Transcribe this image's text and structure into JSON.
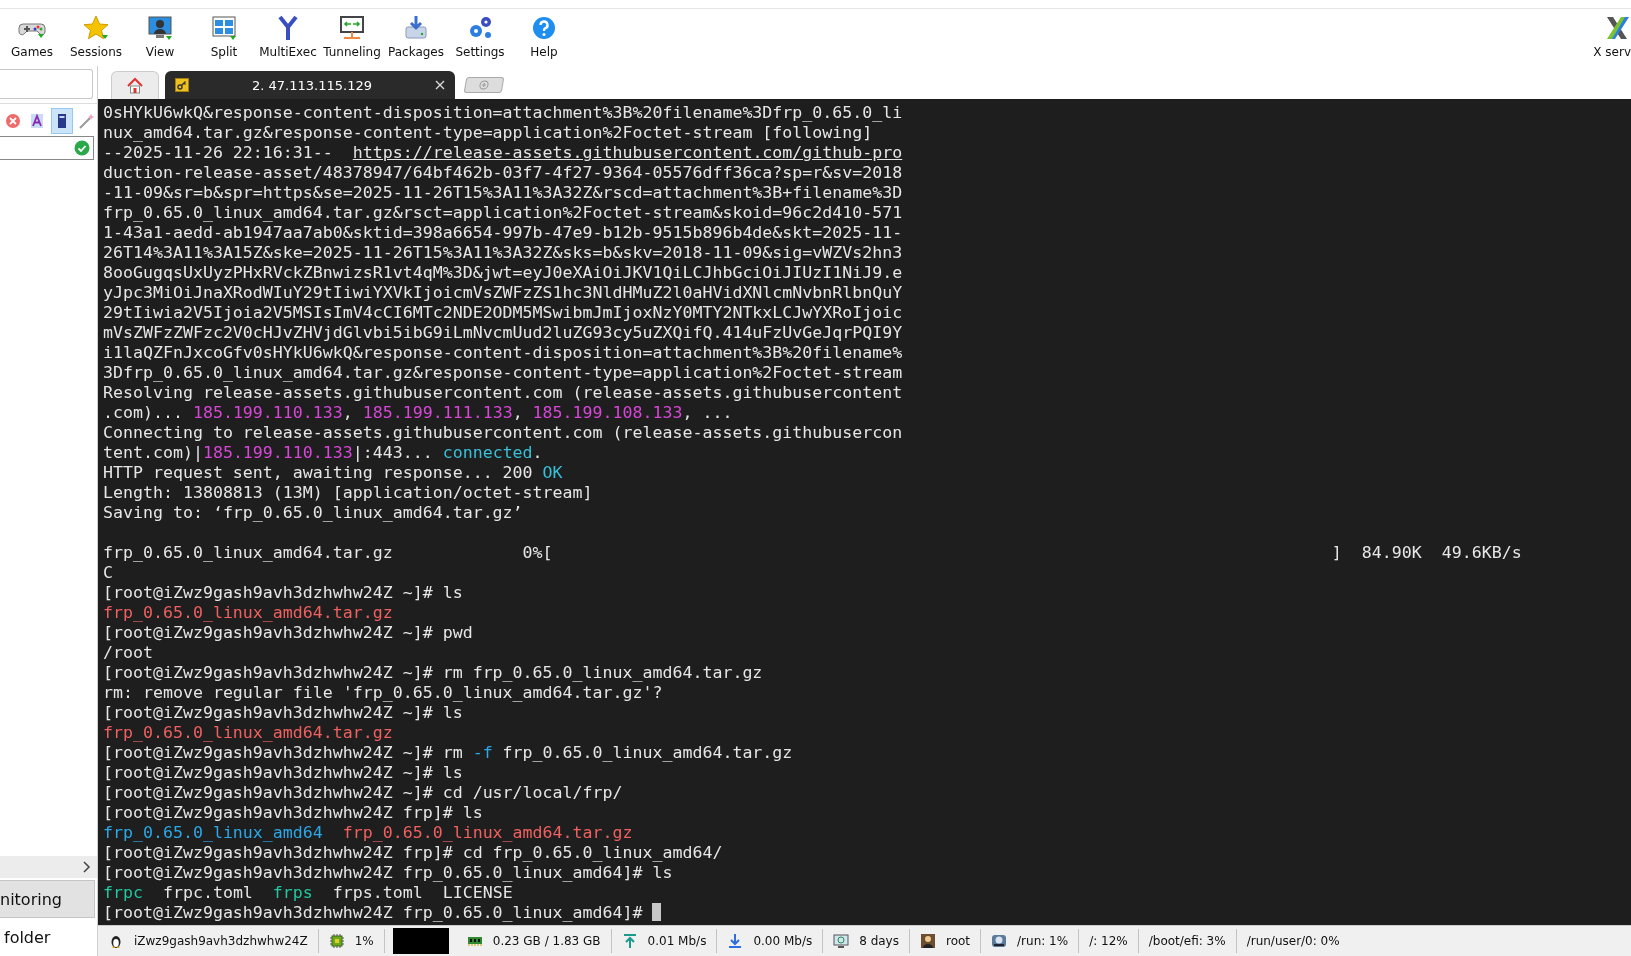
{
  "toolbar": {
    "items": [
      {
        "label": "Games"
      },
      {
        "label": "Sessions"
      },
      {
        "label": "View"
      },
      {
        "label": "Split"
      },
      {
        "label": "MultiExec"
      },
      {
        "label": "Tunneling"
      },
      {
        "label": "Packages"
      },
      {
        "label": "Settings"
      },
      {
        "label": "Help"
      }
    ],
    "right_item": {
      "label": "X serv"
    }
  },
  "sidebar": {
    "tools": [
      {
        "selected": false
      },
      {
        "selected": false
      },
      {
        "selected": true
      },
      {
        "selected": false
      }
    ],
    "bottom_button": "nitoring",
    "bottom_text": "folder"
  },
  "tabs": [
    {
      "kind": "home",
      "selected": false
    },
    {
      "kind": "session",
      "label": "2. 47.113.115.129",
      "selected": true
    }
  ],
  "terminal": {
    "lines": [
      {
        "segments": [
          {
            "kind": "plain",
            "text": "0sHYkU6wkQ&response-content-disposition=attachment%3B%20filename%3Dfrp_0.65.0_li"
          }
        ]
      },
      {
        "segments": [
          {
            "kind": "plain",
            "text": "nux_amd64.tar.gz&response-content-type=application%2Foctet-stream [following]"
          }
        ]
      },
      {
        "segments": [
          {
            "kind": "plain",
            "text": "--2025-11-26 22:16:31--  "
          },
          {
            "kind": "link",
            "text": "https://release-assets.githubusercontent.com/github-pro"
          }
        ]
      },
      {
        "segments": [
          {
            "kind": "plain",
            "text": "duction-release-asset/48378947/64bf462b-03f7-4f27-9364-05576dff36ca?sp=r&sv=2018"
          }
        ]
      },
      {
        "segments": [
          {
            "kind": "plain",
            "text": "-11-09&sr=b&spr=https&se=2025-11-26T15%3A11%3A32Z&rscd=attachment%3B+filename%3D"
          }
        ]
      },
      {
        "segments": [
          {
            "kind": "plain",
            "text": "frp_0.65.0_linux_amd64.tar.gz&rsct=application%2Foctet-stream&skoid=96c2d410-571"
          }
        ]
      },
      {
        "segments": [
          {
            "kind": "plain",
            "text": "1-43a1-aedd-ab1947aa7ab0&sktid=398a6654-997b-47e9-b12b-9515b896b4de&skt=2025-11-"
          }
        ]
      },
      {
        "segments": [
          {
            "kind": "plain",
            "text": "26T14%3A11%3A15Z&ske=2025-11-26T15%3A11%3A32Z&sks=b&skv=2018-11-09&sig=vWZVs2hn3"
          }
        ]
      },
      {
        "segments": [
          {
            "kind": "plain",
            "text": "8ooGugqsUxUyzPHxRVckZBnwizsR1vt4qM%3D&jwt=eyJ0eXAiOiJKV1QiLCJhbGciOiJIUzI1NiJ9.e"
          }
        ]
      },
      {
        "segments": [
          {
            "kind": "plain",
            "text": "yJpc3MiOiJnaXRodWIuY29tIiwiYXVkIjoicmVsZWFzZS1hc3NldHMuZ2l0aHVidXNlcmNvbnRlbnQuY"
          }
        ]
      },
      {
        "segments": [
          {
            "kind": "plain",
            "text": "29tIiwia2V5Ijoia2V5MSIsImV4cCI6MTc2NDE2ODM5MSwibmJmIjoxNzY0MTY2NTkxLCJwYXRoIjoic"
          }
        ]
      },
      {
        "segments": [
          {
            "kind": "plain",
            "text": "mVsZWFzZWFzc2V0cHJvZHVjdGlvbi5ibG9iLmNvcmUud2luZG93cy5uZXQifQ.414uFzUvGeJqrPQI9Y"
          }
        ]
      },
      {
        "segments": [
          {
            "kind": "plain",
            "text": "i1laQZFnJxcoGfv0sHYkU6wkQ&response-content-disposition=attachment%3B%20filename%"
          }
        ]
      },
      {
        "segments": [
          {
            "kind": "plain",
            "text": "3Dfrp_0.65.0_linux_amd64.tar.gz&response-content-type=application%2Foctet-stream"
          }
        ]
      },
      {
        "segments": [
          {
            "kind": "plain",
            "text": "Resolving release-assets.githubusercontent.com (release-assets.githubusercontent"
          }
        ]
      },
      {
        "segments": [
          {
            "kind": "plain",
            "text": ".com)... "
          },
          {
            "kind": "ip",
            "text": "185.199.110.133"
          },
          {
            "kind": "plain",
            "text": ", "
          },
          {
            "kind": "ip",
            "text": "185.199.111.133"
          },
          {
            "kind": "plain",
            "text": ", "
          },
          {
            "kind": "ip",
            "text": "185.199.108.133"
          },
          {
            "kind": "plain",
            "text": ", ..."
          }
        ]
      },
      {
        "segments": [
          {
            "kind": "plain",
            "text": "Connecting to release-assets.githubusercontent.com (release-assets.githubusercon"
          }
        ]
      },
      {
        "segments": [
          {
            "kind": "plain",
            "text": "tent.com)|"
          },
          {
            "kind": "ip",
            "text": "185.199.110.133"
          },
          {
            "kind": "plain",
            "text": "|:443... "
          },
          {
            "kind": "ok",
            "text": "connected"
          },
          {
            "kind": "plain",
            "text": "."
          }
        ]
      },
      {
        "segments": [
          {
            "kind": "plain",
            "text": "HTTP request sent, awaiting response... 200 "
          },
          {
            "kind": "ok",
            "text": "OK"
          }
        ]
      },
      {
        "segments": [
          {
            "kind": "plain",
            "text": "Length: 13808813 (13M) [application/octet-stream]"
          }
        ]
      },
      {
        "segments": [
          {
            "kind": "plain",
            "text": "Saving to: ‘frp_0.65.0_linux_amd64.tar.gz’"
          }
        ]
      },
      {
        "kind": "blank"
      },
      {
        "segments": [
          {
            "kind": "plain",
            "text": "frp_0.65.0_linux_amd64.tar.gz             0%[                                                                              ]  84.90K  49.6KB/s"
          }
        ]
      },
      {
        "segments": [
          {
            "kind": "plain",
            "text": "C"
          }
        ]
      },
      {
        "segments": [
          {
            "kind": "plain",
            "text": "[root@iZwz9gash9avh3dzhwhw24Z ~]# ls"
          }
        ]
      },
      {
        "segments": [
          {
            "kind": "archive",
            "text": "frp_0.65.0_linux_amd64.tar.gz"
          }
        ]
      },
      {
        "segments": [
          {
            "kind": "plain",
            "text": "[root@iZwz9gash9avh3dzhwhw24Z ~]# pwd"
          }
        ]
      },
      {
        "segments": [
          {
            "kind": "plain",
            "text": "/root"
          }
        ]
      },
      {
        "segments": [
          {
            "kind": "plain",
            "text": "[root@iZwz9gash9avh3dzhwhw24Z ~]# rm frp_0.65.0_linux_amd64.tar.gz"
          }
        ]
      },
      {
        "segments": [
          {
            "kind": "plain",
            "text": "rm: remove regular file 'frp_0.65.0_linux_amd64.tar.gz'?"
          }
        ]
      },
      {
        "segments": [
          {
            "kind": "plain",
            "text": "[root@iZwz9gash9avh3dzhwhw24Z ~]# ls"
          }
        ]
      },
      {
        "segments": [
          {
            "kind": "archive",
            "text": "frp_0.65.0_linux_amd64.tar.gz"
          }
        ]
      },
      {
        "segments": [
          {
            "kind": "plain",
            "text": "[root@iZwz9gash9avh3dzhwhw24Z ~]# rm "
          },
          {
            "kind": "flag",
            "text": "-f"
          },
          {
            "kind": "plain",
            "text": " frp_0.65.0_linux_amd64.tar.gz"
          }
        ]
      },
      {
        "segments": [
          {
            "kind": "plain",
            "text": "[root@iZwz9gash9avh3dzhwhw24Z ~]# ls"
          }
        ]
      },
      {
        "segments": [
          {
            "kind": "plain",
            "text": "[root@iZwz9gash9avh3dzhwhw24Z ~]# cd /usr/local/frp/"
          }
        ]
      },
      {
        "segments": [
          {
            "kind": "plain",
            "text": "[root@iZwz9gash9avh3dzhwhw24Z frp]# ls"
          }
        ]
      },
      {
        "segments": [
          {
            "kind": "dir",
            "text": "frp_0.65.0_linux_amd64"
          },
          {
            "kind": "gap"
          },
          {
            "kind": "archive",
            "text": "frp_0.65.0_linux_amd64.tar.gz"
          }
        ]
      },
      {
        "segments": [
          {
            "kind": "plain",
            "text": "[root@iZwz9gash9avh3dzhwhw24Z frp]# cd frp_0.65.0_linux_amd64/"
          }
        ]
      },
      {
        "segments": [
          {
            "kind": "plain",
            "text": "[root@iZwz9gash9avh3dzhwhw24Z frp_0.65.0_linux_amd64]# ls"
          }
        ]
      },
      {
        "segments": [
          {
            "kind": "exec",
            "text": "frpc"
          },
          {
            "kind": "plain",
            "text": "  frpc.toml  "
          },
          {
            "kind": "exec",
            "text": "frps"
          },
          {
            "kind": "plain",
            "text": "  frps.toml  LICENSE"
          }
        ]
      },
      {
        "segments": [
          {
            "kind": "plain",
            "text": "[root@iZwz9gash9avh3dzhwhw24Z frp_0.65.0_linux_amd64]# "
          },
          {
            "kind": "cursor"
          }
        ]
      }
    ]
  },
  "status_bar": [
    {
      "kind": "text",
      "text": "iZwz9gash9avh3dzhwhw24Z"
    },
    {
      "kind": "text",
      "text": "1%"
    },
    {
      "kind": "graph"
    },
    {
      "kind": "text",
      "text": "0.23 GB / 1.83 GB"
    },
    {
      "kind": "text",
      "text": "0.01 Mb/s"
    },
    {
      "kind": "text",
      "text": "0.00 Mb/s"
    },
    {
      "kind": "text",
      "text": "8 days"
    },
    {
      "kind": "text",
      "text": "root"
    },
    {
      "kind": "text",
      "text": "/run: 1%"
    },
    {
      "kind": "text",
      "text": "/: 12%"
    },
    {
      "kind": "text",
      "text": "/boot/efi: 3%"
    },
    {
      "kind": "text",
      "text": "/run/user/0: 0%"
    }
  ]
}
